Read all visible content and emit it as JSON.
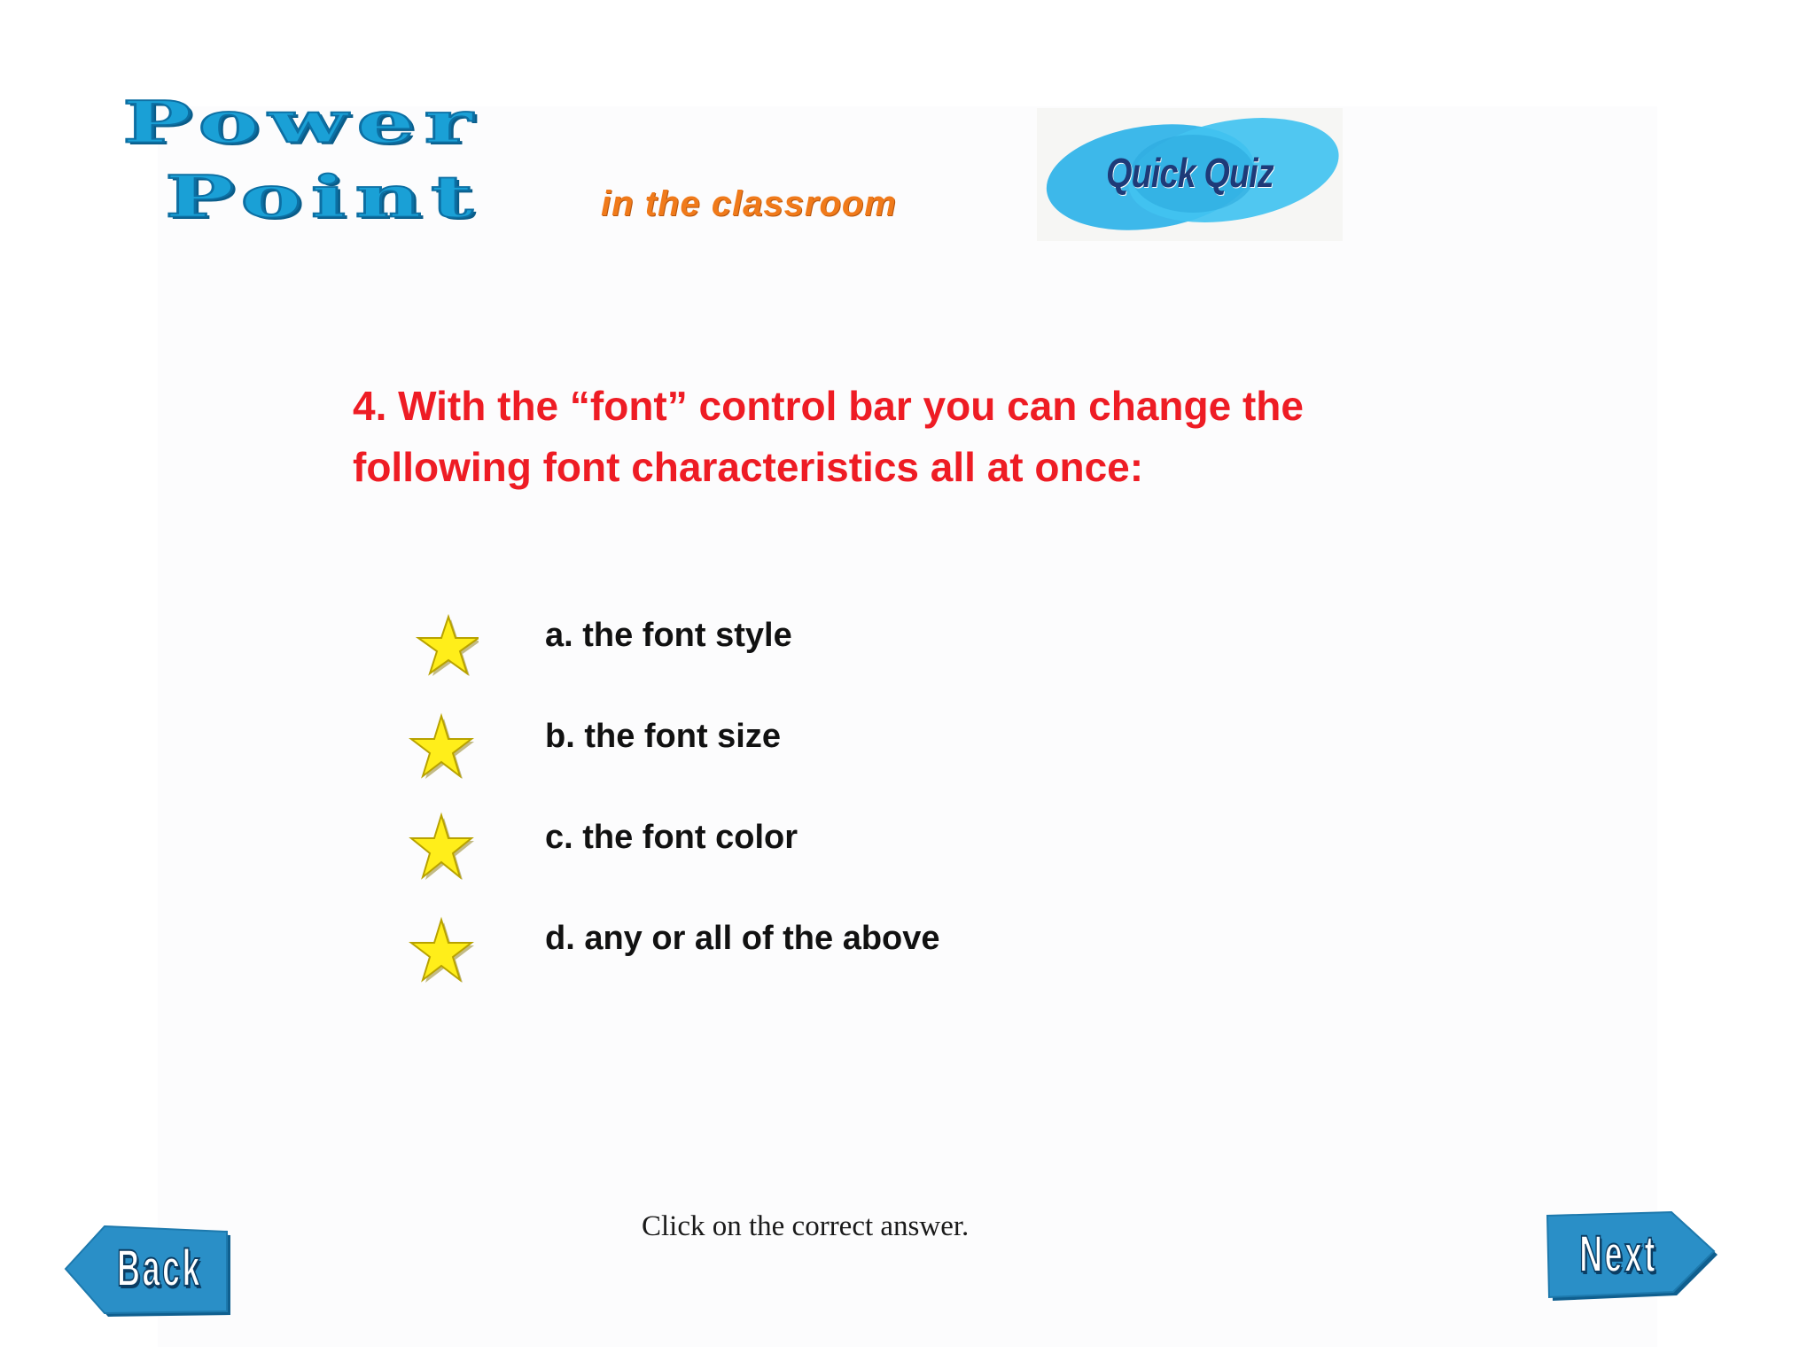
{
  "logo": {
    "word1": "Power",
    "word2": "Point",
    "tagline": "in the classroom"
  },
  "badge": {
    "label": "Quick Quiz"
  },
  "question": {
    "line1": "4.  With the “font” control bar you can change the",
    "line2": "following font characteristics all at once:"
  },
  "answers": [
    {
      "label": "a. the font style"
    },
    {
      "label": "b. the font size"
    },
    {
      "label": "c. the font color"
    },
    {
      "label": "d. any or all of the above"
    }
  ],
  "instruction": "Click on the correct answer.",
  "nav": {
    "back_label": "Back",
    "next_label": "Next"
  },
  "colors": {
    "question": "#ee1c24",
    "logo_blue": "#1aa0d6",
    "logo_orange": "#f07a1a",
    "star_yellow": "#ffee1a",
    "nav_blue": "#2a8fc7"
  },
  "icons": {
    "answer_marker": "star-icon",
    "back": "left-arrow-icon",
    "next": "right-arrow-icon"
  }
}
